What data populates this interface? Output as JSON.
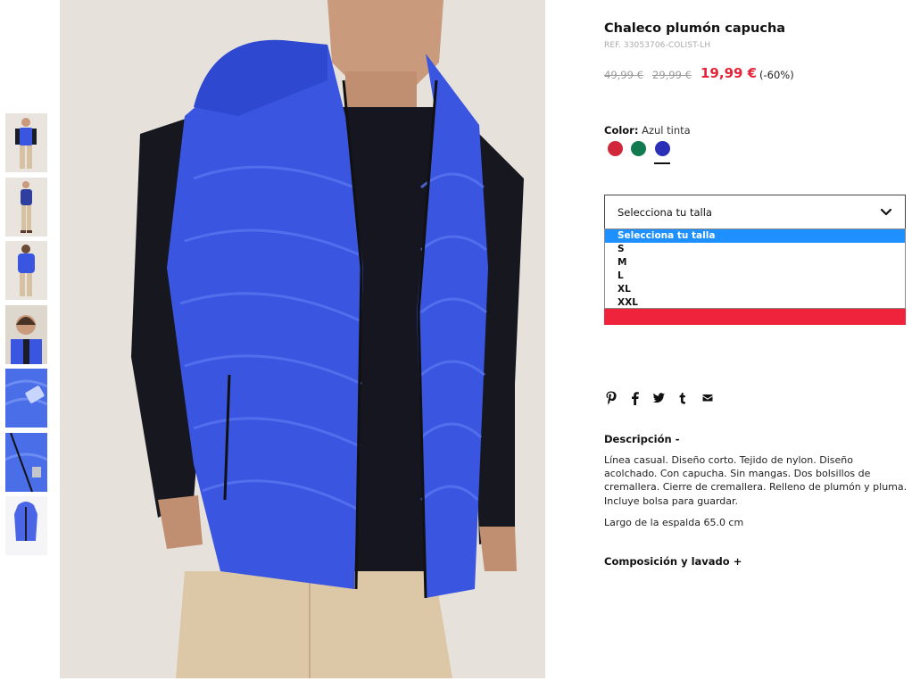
{
  "product": {
    "title": "Chaleco plumón capucha",
    "ref": "REF. 33053706-COLIST-LH",
    "price_original": "49,99 €",
    "price_previous": "29,99 €",
    "price_current": "19,99 €",
    "discount": "(-60%)"
  },
  "color": {
    "label": "Color:",
    "selected": "Azul tinta",
    "swatches": [
      {
        "name": "Rojo",
        "hex": "#d0283a"
      },
      {
        "name": "Verde",
        "hex": "#127a4e"
      },
      {
        "name": "Azul tinta",
        "hex": "#2a2fb8"
      }
    ]
  },
  "size": {
    "placeholder": "Selecciona tu talla",
    "options": [
      "Selecciona tu talla",
      "S",
      "M",
      "L",
      "XL",
      "XXL"
    ]
  },
  "social": {
    "icons": [
      "pinterest-icon",
      "facebook-icon",
      "twitter-icon",
      "tumblr-icon",
      "email-icon"
    ]
  },
  "description": {
    "title": "Descripción -",
    "text": "Línea casual. Diseño corto. Tejido de nylon. Diseño acolchado. Con capucha. Sin mangas. Dos bolsillos de cremallera. Cierre de cremallera. Relleno de plumón y pluma. Incluye bolsa para guardar.",
    "length": "Largo de la espalda 65.0 cm"
  },
  "composition": {
    "title": "Composición y lavado +"
  },
  "colors": {
    "accent_red": "#f0233c",
    "price_red": "#e5243a",
    "jacket_blue": "#3a55e0",
    "select_highlight": "#1e90ff"
  }
}
